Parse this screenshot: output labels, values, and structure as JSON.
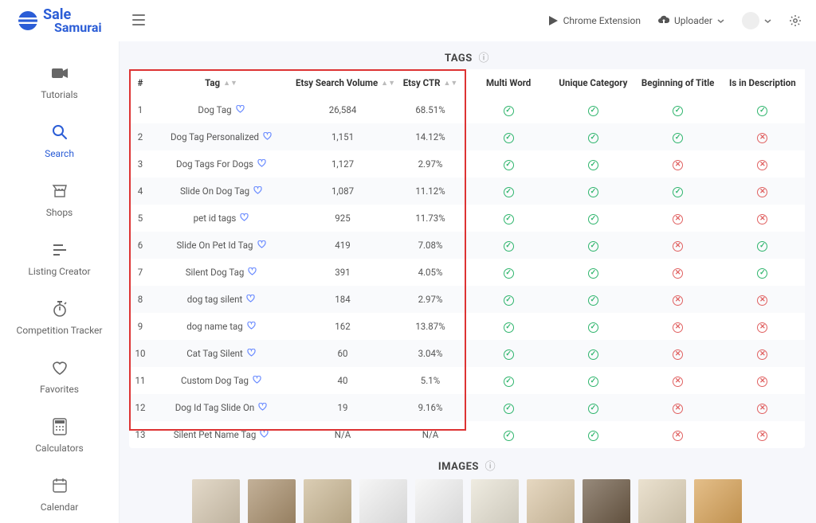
{
  "brand": {
    "line1": "Sale",
    "line2": "Samurai"
  },
  "topbar": {
    "chrome_ext": "Chrome Extension",
    "uploader": "Uploader"
  },
  "sidebar": {
    "items": [
      {
        "label": "Tutorials"
      },
      {
        "label": "Search"
      },
      {
        "label": "Shops"
      },
      {
        "label": "Listing Creator"
      },
      {
        "label": "Competition Tracker"
      },
      {
        "label": "Favorites"
      },
      {
        "label": "Calculators"
      },
      {
        "label": "Calendar"
      }
    ]
  },
  "section": {
    "tags_title": "TAGS",
    "images_title": "IMAGES"
  },
  "columns": {
    "idx": "#",
    "tag": "Tag",
    "vol": "Etsy Search Volume",
    "ctr": "Etsy CTR",
    "multi": "Multi Word",
    "uniq": "Unique Category",
    "bot": "Beginning of Title",
    "desc": "Is in Description"
  },
  "rows": [
    {
      "n": "1",
      "tag": "Dog Tag",
      "vol": "26,584",
      "ctr": "68.51%",
      "multi": true,
      "uniq": true,
      "bot": true,
      "desc": true
    },
    {
      "n": "2",
      "tag": "Dog Tag Personalized",
      "vol": "1,151",
      "ctr": "14.12%",
      "multi": true,
      "uniq": true,
      "bot": true,
      "desc": false
    },
    {
      "n": "3",
      "tag": "Dog Tags For Dogs",
      "vol": "1,127",
      "ctr": "2.97%",
      "multi": true,
      "uniq": true,
      "bot": false,
      "desc": false
    },
    {
      "n": "4",
      "tag": "Slide On Dog Tag",
      "vol": "1,087",
      "ctr": "11.12%",
      "multi": true,
      "uniq": true,
      "bot": true,
      "desc": false
    },
    {
      "n": "5",
      "tag": "pet id tags",
      "vol": "925",
      "ctr": "11.73%",
      "multi": true,
      "uniq": true,
      "bot": false,
      "desc": false
    },
    {
      "n": "6",
      "tag": "Slide On Pet Id Tag",
      "vol": "419",
      "ctr": "7.08%",
      "multi": true,
      "uniq": true,
      "bot": false,
      "desc": true
    },
    {
      "n": "7",
      "tag": "Silent Dog Tag",
      "vol": "391",
      "ctr": "4.05%",
      "multi": true,
      "uniq": true,
      "bot": false,
      "desc": true
    },
    {
      "n": "8",
      "tag": "dog tag silent",
      "vol": "184",
      "ctr": "2.97%",
      "multi": true,
      "uniq": true,
      "bot": false,
      "desc": false
    },
    {
      "n": "9",
      "tag": "dog name tag",
      "vol": "162",
      "ctr": "13.87%",
      "multi": true,
      "uniq": true,
      "bot": false,
      "desc": false
    },
    {
      "n": "10",
      "tag": "Cat Tag Silent",
      "vol": "60",
      "ctr": "3.04%",
      "multi": true,
      "uniq": true,
      "bot": false,
      "desc": false
    },
    {
      "n": "11",
      "tag": "Custom Dog Tag",
      "vol": "40",
      "ctr": "5.1%",
      "multi": true,
      "uniq": true,
      "bot": false,
      "desc": false
    },
    {
      "n": "12",
      "tag": "Dog Id Tag Slide On",
      "vol": "19",
      "ctr": "9.16%",
      "multi": true,
      "uniq": true,
      "bot": false,
      "desc": false
    },
    {
      "n": "13",
      "tag": "Silent Pet Name Tag",
      "vol": "N/A",
      "ctr": "N/A",
      "multi": true,
      "uniq": true,
      "bot": false,
      "desc": false
    }
  ]
}
